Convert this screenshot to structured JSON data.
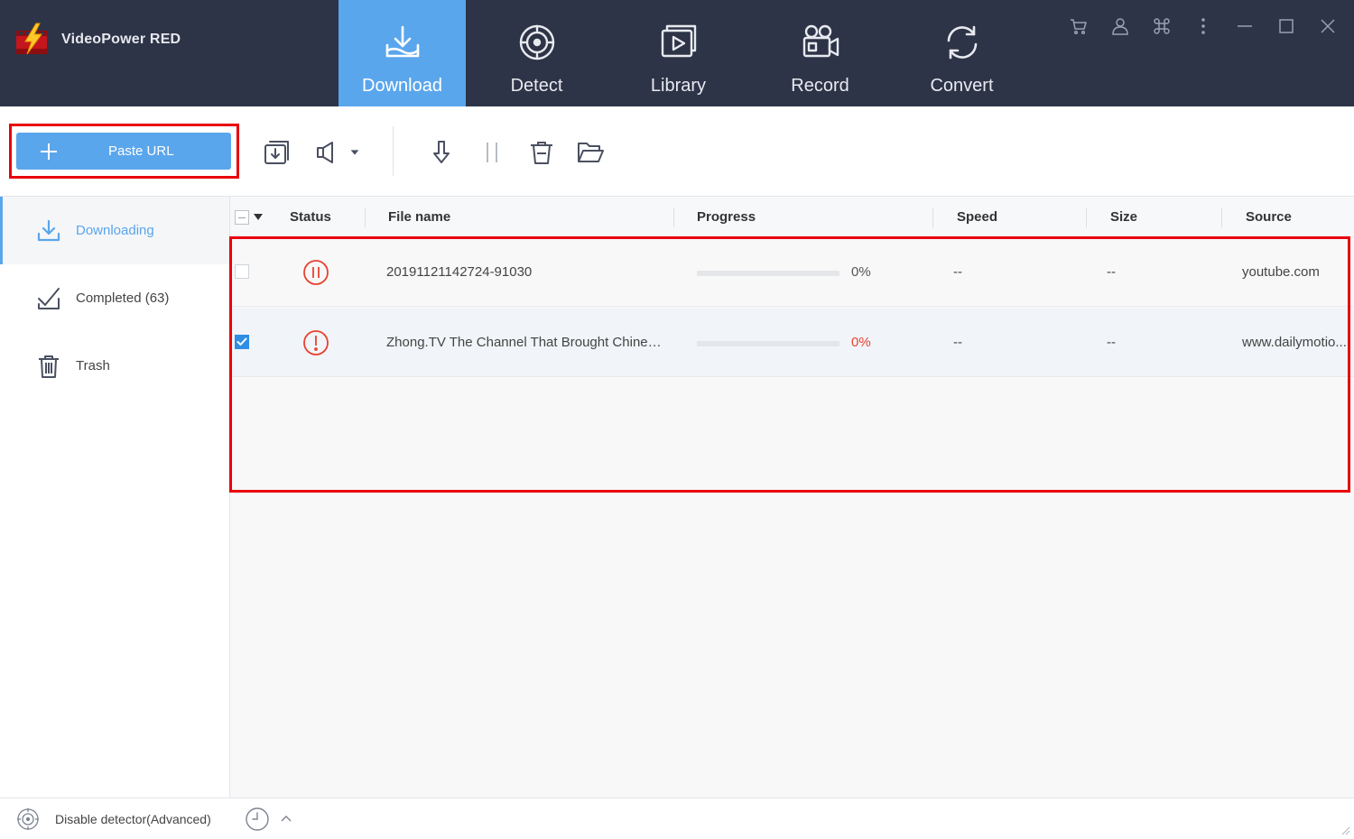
{
  "app": {
    "name": "VideoPower RED"
  },
  "nav": {
    "tabs": [
      {
        "label": "Download",
        "icon": "download-tray-icon",
        "active": true
      },
      {
        "label": "Detect",
        "icon": "target-icon",
        "active": false
      },
      {
        "label": "Library",
        "icon": "video-library-icon",
        "active": false
      },
      {
        "label": "Record",
        "icon": "video-camera-icon",
        "active": false
      },
      {
        "label": "Convert",
        "icon": "convert-cycle-icon",
        "active": false
      }
    ]
  },
  "window_controls": [
    "cart-icon",
    "user-icon",
    "command-icon",
    "more-vertical-icon",
    "minimize-icon",
    "maximize-icon",
    "close-icon"
  ],
  "toolbar": {
    "paste_label": "Paste URL",
    "buttons": [
      "download-to-icon",
      "speaker-icon",
      "resume-icon",
      "pause-icon",
      "delete-icon",
      "open-folder-icon"
    ]
  },
  "sidebar": {
    "items": [
      {
        "label": "Downloading",
        "icon": "download-icon",
        "active": true
      },
      {
        "label": "Completed (63)",
        "icon": "completed-check-icon",
        "active": false
      },
      {
        "label": "Trash",
        "icon": "trash-icon",
        "active": false
      }
    ]
  },
  "table": {
    "columns": [
      "Status",
      "File name",
      "Progress",
      "Speed",
      "Size",
      "Source"
    ],
    "rows": [
      {
        "checked": false,
        "status": "paused",
        "file_name": "20191121142724-91030",
        "progress": 0,
        "progress_text": "0%",
        "speed": "--",
        "size": "--",
        "source": "youtube.com"
      },
      {
        "checked": true,
        "status": "error",
        "file_name": "Zhong.TV The Channel That Brought Chinese ...",
        "progress": 0,
        "progress_text": "0%",
        "speed": "--",
        "size": "--",
        "source": "www.dailymotio..."
      }
    ]
  },
  "statusbar": {
    "detector_label": "Disable detector(Advanced)"
  },
  "colors": {
    "accent": "#5aa6ec",
    "topbar": "#2d3447",
    "error": "#e8422f",
    "highlight": "#e8000b"
  }
}
